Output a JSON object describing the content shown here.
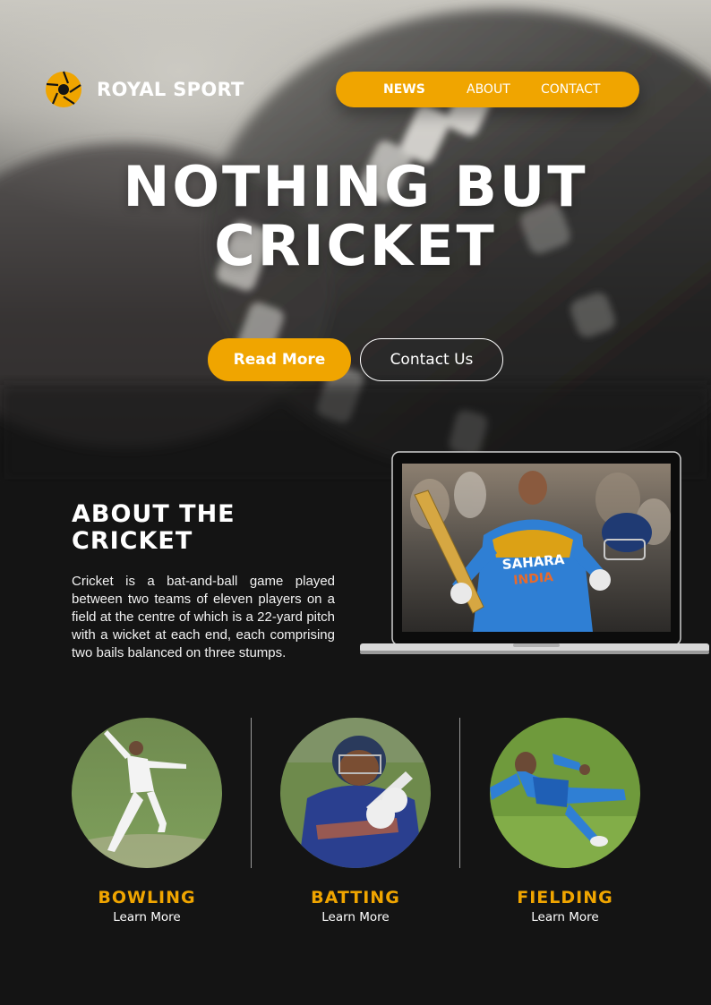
{
  "brand": {
    "name": "ROYAL SPORT",
    "icon": "aperture-logo-icon"
  },
  "nav": {
    "items": [
      "NEWS",
      "ABOUT",
      "CONTACT"
    ],
    "active": "NEWS"
  },
  "hero": {
    "title_line1": "NOTHING BUT",
    "title_line2": "CRICKET",
    "image": "cricket-ball-closeup"
  },
  "buttons": {
    "primary": "Read More",
    "secondary": "Contact Us"
  },
  "about": {
    "title_line1": "ABOUT THE",
    "title_line2": "CRICKET",
    "text": "Cricket is a bat-and-ball game played between two teams of eleven players on a field at the centre of which is a 22-yard pitch with a wicket at each end, each comprising two bails balanced on three stumps.",
    "image": "laptop-showing-cricketer-celebrating"
  },
  "categories": [
    {
      "title": "BOWLING",
      "link": "Learn More",
      "image": "bowler-photo"
    },
    {
      "title": "BATTING",
      "link": "Learn More",
      "image": "batsman-photo"
    },
    {
      "title": "FIELDING",
      "link": "Learn More",
      "image": "fielder-photo"
    }
  ],
  "colors": {
    "accent": "#f0a500",
    "background": "#141414",
    "text": "#ffffff"
  }
}
